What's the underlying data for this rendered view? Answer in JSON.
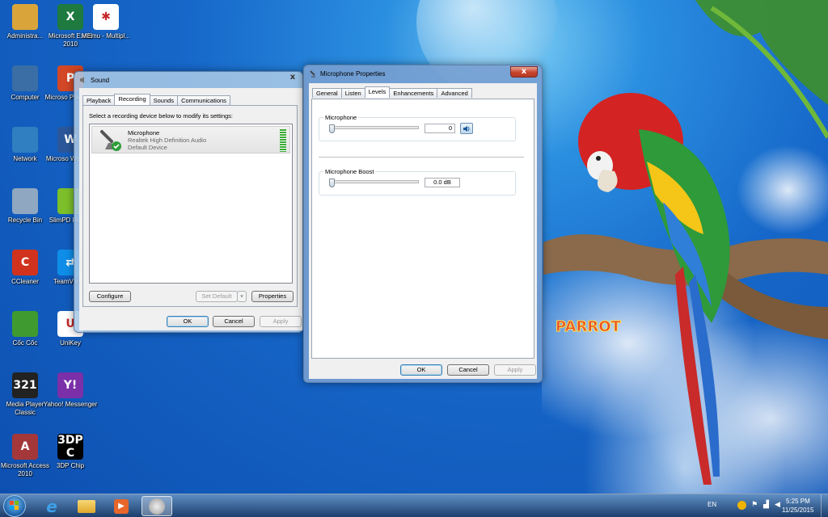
{
  "desktop": {
    "icons": [
      {
        "label": "Administra...",
        "glyph": "",
        "color": "#d9a53a"
      },
      {
        "label": "Microsoft Excel 2010",
        "glyph": "X",
        "color": "#1e7a3e"
      },
      {
        "label": "MEmu - Multipl...",
        "glyph": "✱",
        "color": "#ffffff"
      },
      {
        "label": "Computer",
        "glyph": "",
        "color": "#3a6ea5"
      },
      {
        "label": "Microso PowerPo",
        "glyph": "P",
        "color": "#d24726"
      },
      {
        "label": "Network",
        "glyph": "",
        "color": "#2f7fc1"
      },
      {
        "label": "Microso Word 20",
        "glyph": "W",
        "color": "#2b579a"
      },
      {
        "label": "Recycle Bin",
        "glyph": "",
        "color": "#8fa7c0"
      },
      {
        "label": "SlimPD Reade",
        "glyph": "",
        "color": "#7cbf2a"
      },
      {
        "label": "CCleaner",
        "glyph": "C",
        "color": "#d0321d"
      },
      {
        "label": "TeamVie 10",
        "glyph": "⇄",
        "color": "#0e8ee9"
      },
      {
        "label": "Cốc Cốc",
        "glyph": "",
        "color": "#3f9b2f"
      },
      {
        "label": "UniKey",
        "glyph": "U",
        "color": "#ffffff"
      },
      {
        "label": "Media Player Classic",
        "glyph": "321",
        "color": "#222222"
      },
      {
        "label": "Yahoo! Messenger",
        "glyph": "Y!",
        "color": "#7b2fa8"
      },
      {
        "label": "Microsoft Access 2010",
        "glyph": "A",
        "color": "#a4373a"
      },
      {
        "label": "3DP Chip",
        "glyph": "3DP C",
        "color": "#000000"
      }
    ],
    "wallpaper_text": "PARROT"
  },
  "sound_dialog": {
    "title": "Sound",
    "close_glyph": "x",
    "tabs": [
      "Playback",
      "Recording",
      "Sounds",
      "Communications"
    ],
    "active_tab": "Recording",
    "instruction": "Select a recording device below to modify its settings:",
    "device": {
      "name": "Microphone",
      "driver": "Realtek High Definition Audio",
      "status": "Default Device"
    },
    "buttons": {
      "configure": "Configure",
      "set_default": "Set Default",
      "properties": "Properties",
      "ok": "OK",
      "cancel": "Cancel",
      "apply": "Apply"
    }
  },
  "mic_dialog": {
    "title": "Microphone Properties",
    "close_glyph": "x",
    "tabs": [
      "General",
      "Listen",
      "Levels",
      "Enhancements",
      "Advanced"
    ],
    "active_tab": "Levels",
    "microphone_label": "Microphone",
    "microphone_value": "0",
    "microphone_level": 0,
    "boost_label": "Microphone Boost",
    "boost_value": "0.0 dB",
    "boost_level": 0,
    "buttons": {
      "ok": "OK",
      "cancel": "Cancel",
      "apply": "Apply"
    }
  },
  "taskbar": {
    "language": "EN",
    "time": "5:25 PM",
    "date": "11/25/2015"
  },
  "colors": {
    "accent": "#3c7fb1",
    "level_meter": "#3aaa35"
  }
}
